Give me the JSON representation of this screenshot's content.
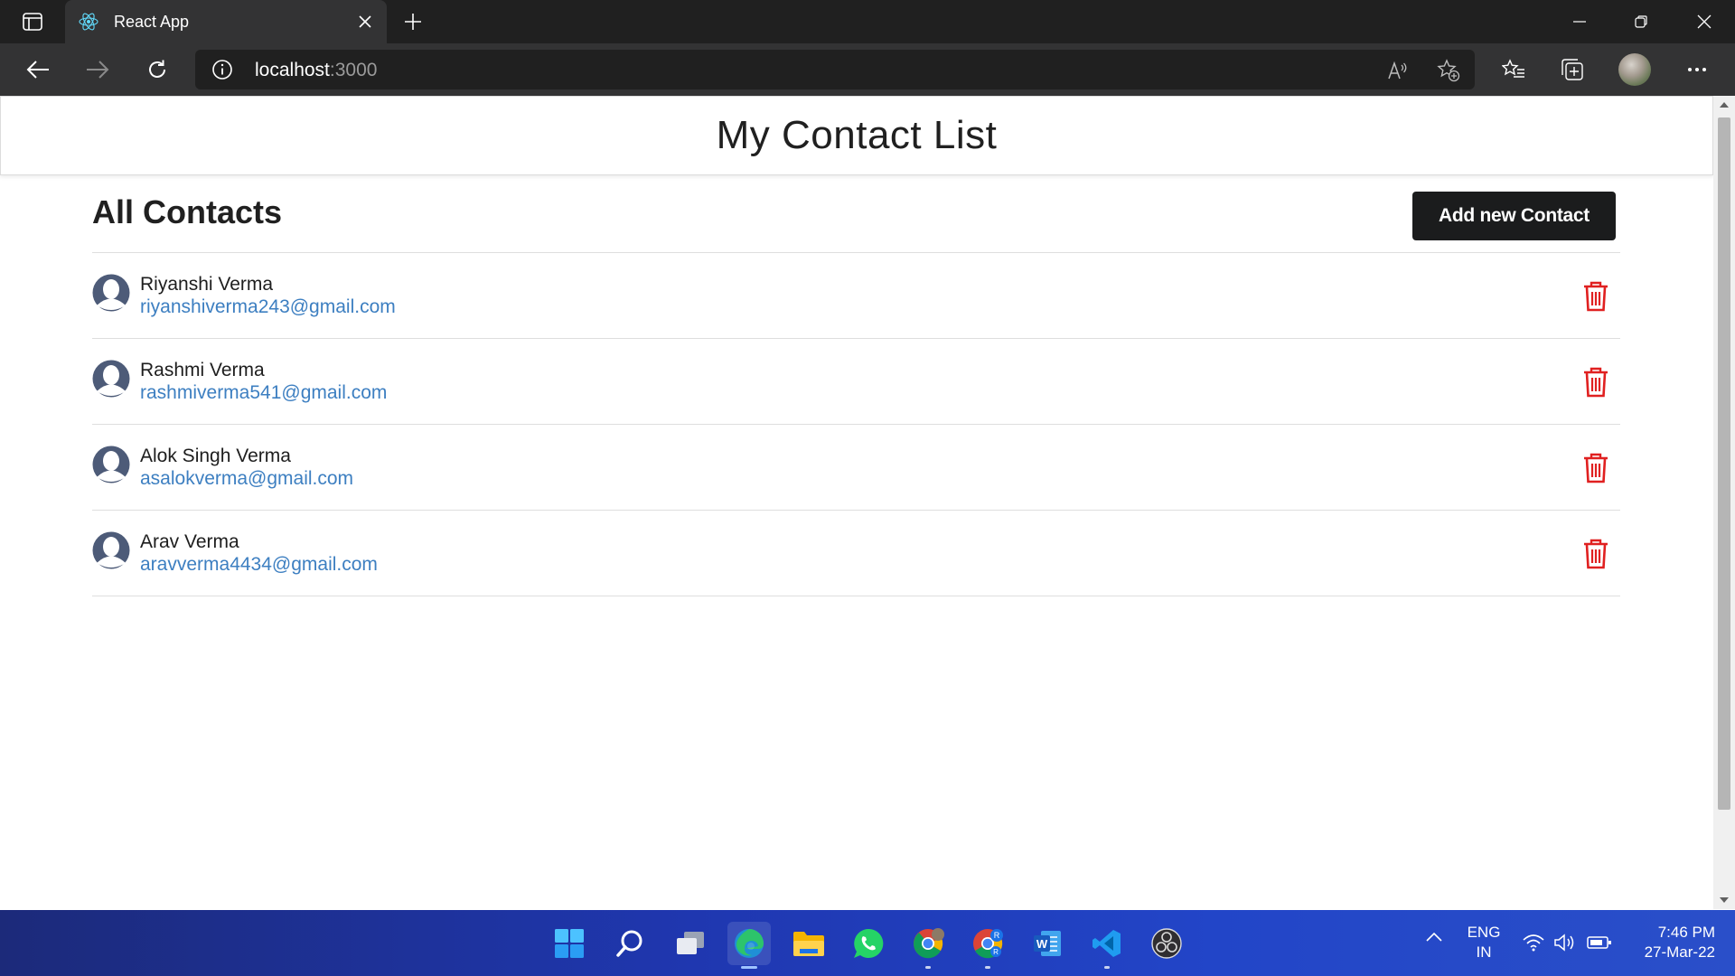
{
  "browser": {
    "tab_title": "React App",
    "url_host": "localhost",
    "url_port": ":3000"
  },
  "app": {
    "title": "My Contact List",
    "section_title": "All Contacts",
    "add_button_label": "Add new Contact"
  },
  "contacts": [
    {
      "name": "Riyanshi Verma",
      "email": "riyanshiverma243@gmail.com"
    },
    {
      "name": "Rashmi Verma",
      "email": "rashmiverma541@gmail.com"
    },
    {
      "name": "Alok Singh Verma",
      "email": "asalokverma@gmail.com"
    },
    {
      "name": "Arav Verma",
      "email": "aravverma4434@gmail.com"
    }
  ],
  "colors": {
    "delete_icon": "#e02020",
    "email_link": "#3d7fc1",
    "add_button_bg": "#1b1c1d",
    "taskbar": "#1f37b0"
  },
  "taskbar": {
    "apps": [
      "start-icon",
      "search-icon",
      "task-view-icon",
      "edge-icon",
      "file-explorer-icon",
      "whatsapp-icon",
      "chrome-icon",
      "chrome-profile-icon",
      "word-icon",
      "vscode-icon",
      "obs-icon"
    ],
    "tray": {
      "language_line1": "ENG",
      "language_line2": "IN",
      "time": "7:46 PM",
      "date": "27-Mar-22"
    }
  }
}
